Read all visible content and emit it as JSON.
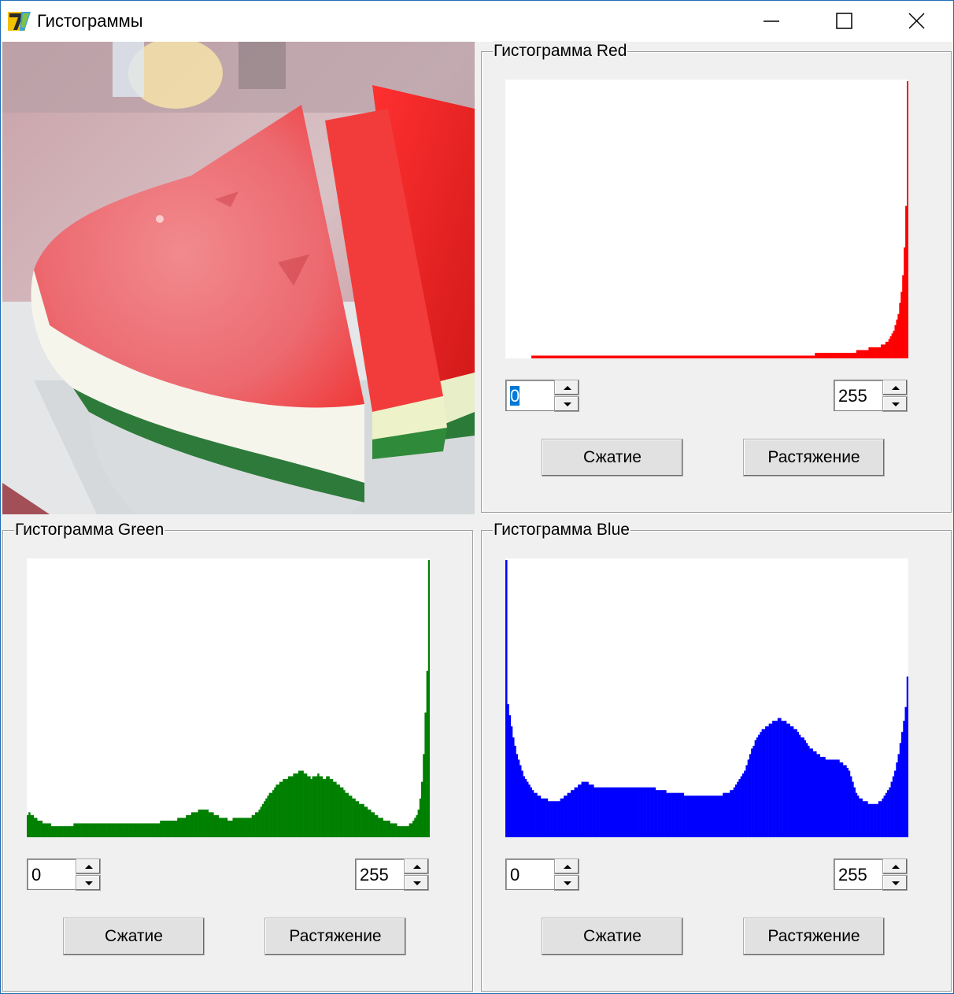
{
  "window": {
    "title": "Гистограммы"
  },
  "panels": {
    "red": {
      "caption": "Гистограмма Red",
      "color": "#ff0000",
      "min_value": "0",
      "max_value": "255",
      "compress_label": "Сжатие",
      "stretch_label": "Растяжение"
    },
    "green": {
      "caption": "Гистограмма Green",
      "color": "#008000",
      "min_value": "0",
      "max_value": "255",
      "compress_label": "Сжатие",
      "stretch_label": "Растяжение"
    },
    "blue": {
      "caption": "Гистограмма Blue",
      "color": "#0000ff",
      "min_value": "0",
      "max_value": "255",
      "compress_label": "Сжатие",
      "stretch_label": "Растяжение"
    }
  },
  "chart_data": [
    {
      "type": "area",
      "series": [
        {
          "values": [
            0,
            0,
            0,
            0,
            0,
            0,
            0,
            0,
            0,
            0,
            0,
            0,
            0,
            0,
            0,
            0,
            0,
            1,
            1,
            1,
            1,
            1,
            1,
            1,
            1,
            1,
            1,
            1,
            1,
            1,
            1,
            1,
            1,
            1,
            1,
            1,
            1,
            1,
            1,
            1,
            1,
            1,
            1,
            1,
            1,
            1,
            1,
            1,
            1,
            1,
            1,
            1,
            1,
            1,
            1,
            1,
            1,
            1,
            1,
            1,
            1,
            1,
            1,
            1,
            1,
            1,
            1,
            1,
            1,
            1,
            1,
            1,
            1,
            1,
            1,
            1,
            1,
            1,
            1,
            1,
            1,
            1,
            1,
            1,
            1,
            1,
            1,
            1,
            1,
            1,
            1,
            1,
            1,
            1,
            1,
            1,
            1,
            1,
            1,
            1,
            1,
            1,
            1,
            1,
            1,
            1,
            1,
            1,
            1,
            1,
            1,
            1,
            1,
            1,
            1,
            1,
            1,
            1,
            1,
            1,
            1,
            1,
            1,
            1,
            1,
            1,
            1,
            1,
            1,
            1,
            1,
            1,
            1,
            1,
            1,
            1,
            1,
            1,
            1,
            1,
            1,
            1,
            1,
            1,
            1,
            1,
            1,
            1,
            1,
            1,
            1,
            1,
            1,
            1,
            1,
            1,
            1,
            1,
            1,
            1,
            1,
            1,
            1,
            1,
            1,
            1,
            1,
            1,
            1,
            1,
            1,
            1,
            1,
            1,
            1,
            1,
            1,
            1,
            1,
            1,
            1,
            1,
            1,
            1,
            1,
            1,
            1,
            1,
            1,
            1,
            1,
            1,
            1,
            1,
            1,
            1,
            1,
            1,
            1,
            1,
            1,
            1,
            2,
            2,
            2,
            2,
            2,
            2,
            2,
            2,
            2,
            2,
            2,
            2,
            2,
            2,
            2,
            2,
            2,
            2,
            2,
            2,
            2,
            2,
            2,
            2,
            2,
            2,
            2,
            3,
            3,
            3,
            3,
            3,
            3,
            3,
            3,
            4,
            4,
            4,
            4,
            4,
            4,
            4,
            4,
            5,
            5,
            5,
            6,
            6,
            7,
            8,
            9,
            10,
            12,
            14,
            16,
            20,
            24,
            30,
            40,
            55,
            100
          ]
        }
      ]
    },
    {
      "type": "area",
      "series": [
        {
          "values": [
            8,
            9,
            8,
            8,
            7,
            7,
            6,
            6,
            6,
            5,
            5,
            5,
            5,
            5,
            4,
            4,
            4,
            4,
            4,
            4,
            4,
            4,
            4,
            4,
            4,
            4,
            4,
            5,
            5,
            5,
            5,
            5,
            5,
            5,
            5,
            5,
            5,
            5,
            5,
            5,
            5,
            5,
            5,
            5,
            5,
            5,
            5,
            5,
            5,
            5,
            5,
            5,
            5,
            5,
            5,
            5,
            5,
            5,
            5,
            5,
            5,
            5,
            5,
            5,
            5,
            5,
            5,
            5,
            5,
            5,
            5,
            5,
            5,
            5,
            5,
            5,
            5,
            6,
            6,
            6,
            6,
            6,
            6,
            6,
            6,
            6,
            6,
            7,
            7,
            7,
            7,
            7,
            8,
            8,
            8,
            9,
            9,
            9,
            9,
            10,
            10,
            10,
            10,
            10,
            10,
            9,
            9,
            9,
            8,
            8,
            8,
            7,
            7,
            7,
            7,
            7,
            6,
            6,
            6,
            7,
            7,
            7,
            7,
            7,
            7,
            7,
            7,
            7,
            7,
            7,
            8,
            8,
            9,
            9,
            10,
            11,
            12,
            13,
            14,
            15,
            16,
            16,
            17,
            18,
            19,
            19,
            20,
            20,
            21,
            21,
            21,
            22,
            22,
            22,
            23,
            23,
            23,
            24,
            24,
            24,
            23,
            23,
            22,
            22,
            21,
            22,
            22,
            22,
            23,
            22,
            22,
            21,
            21,
            22,
            22,
            21,
            21,
            20,
            20,
            19,
            19,
            18,
            18,
            17,
            16,
            16,
            15,
            15,
            14,
            14,
            13,
            13,
            12,
            12,
            12,
            11,
            11,
            10,
            10,
            9,
            9,
            8,
            8,
            7,
            7,
            7,
            6,
            6,
            6,
            6,
            5,
            5,
            5,
            5,
            4,
            4,
            4,
            4,
            4,
            4,
            4,
            5,
            5,
            6,
            7,
            8,
            10,
            14,
            20,
            30,
            45,
            60,
            100
          ]
        }
      ]
    },
    {
      "type": "area",
      "series": [
        {
          "values": [
            100,
            48,
            44,
            40,
            36,
            33,
            30,
            28,
            26,
            24,
            22,
            21,
            20,
            19,
            18,
            17,
            16,
            16,
            15,
            15,
            14,
            14,
            14,
            14,
            13,
            13,
            13,
            13,
            13,
            13,
            13,
            14,
            14,
            15,
            15,
            16,
            16,
            17,
            17,
            18,
            18,
            19,
            19,
            20,
            20,
            20,
            20,
            19,
            19,
            19,
            18,
            18,
            18,
            18,
            18,
            18,
            18,
            18,
            18,
            18,
            18,
            18,
            18,
            18,
            18,
            18,
            18,
            18,
            18,
            18,
            18,
            18,
            18,
            18,
            18,
            18,
            18,
            18,
            18,
            18,
            18,
            18,
            18,
            18,
            18,
            17,
            17,
            17,
            17,
            17,
            17,
            16,
            16,
            16,
            16,
            16,
            16,
            16,
            16,
            16,
            16,
            15,
            15,
            15,
            15,
            15,
            15,
            15,
            15,
            15,
            15,
            15,
            15,
            15,
            15,
            15,
            15,
            15,
            15,
            15,
            15,
            15,
            15,
            16,
            16,
            16,
            16,
            17,
            17,
            18,
            19,
            20,
            21,
            22,
            23,
            24,
            26,
            28,
            30,
            32,
            33,
            35,
            36,
            37,
            38,
            39,
            39,
            40,
            40,
            41,
            41,
            42,
            42,
            42,
            43,
            43,
            42,
            42,
            42,
            41,
            41,
            40,
            40,
            39,
            39,
            38,
            37,
            36,
            36,
            35,
            34,
            33,
            32,
            32,
            31,
            31,
            30,
            30,
            29,
            29,
            29,
            28,
            28,
            28,
            28,
            28,
            28,
            28,
            28,
            27,
            27,
            26,
            26,
            25,
            24,
            22,
            20,
            18,
            16,
            15,
            14,
            14,
            13,
            13,
            13,
            12,
            12,
            12,
            12,
            12,
            12,
            13,
            13,
            14,
            15,
            16,
            17,
            18,
            20,
            22,
            24,
            27,
            30,
            34,
            38,
            42,
            47,
            58
          ]
        }
      ]
    }
  ]
}
